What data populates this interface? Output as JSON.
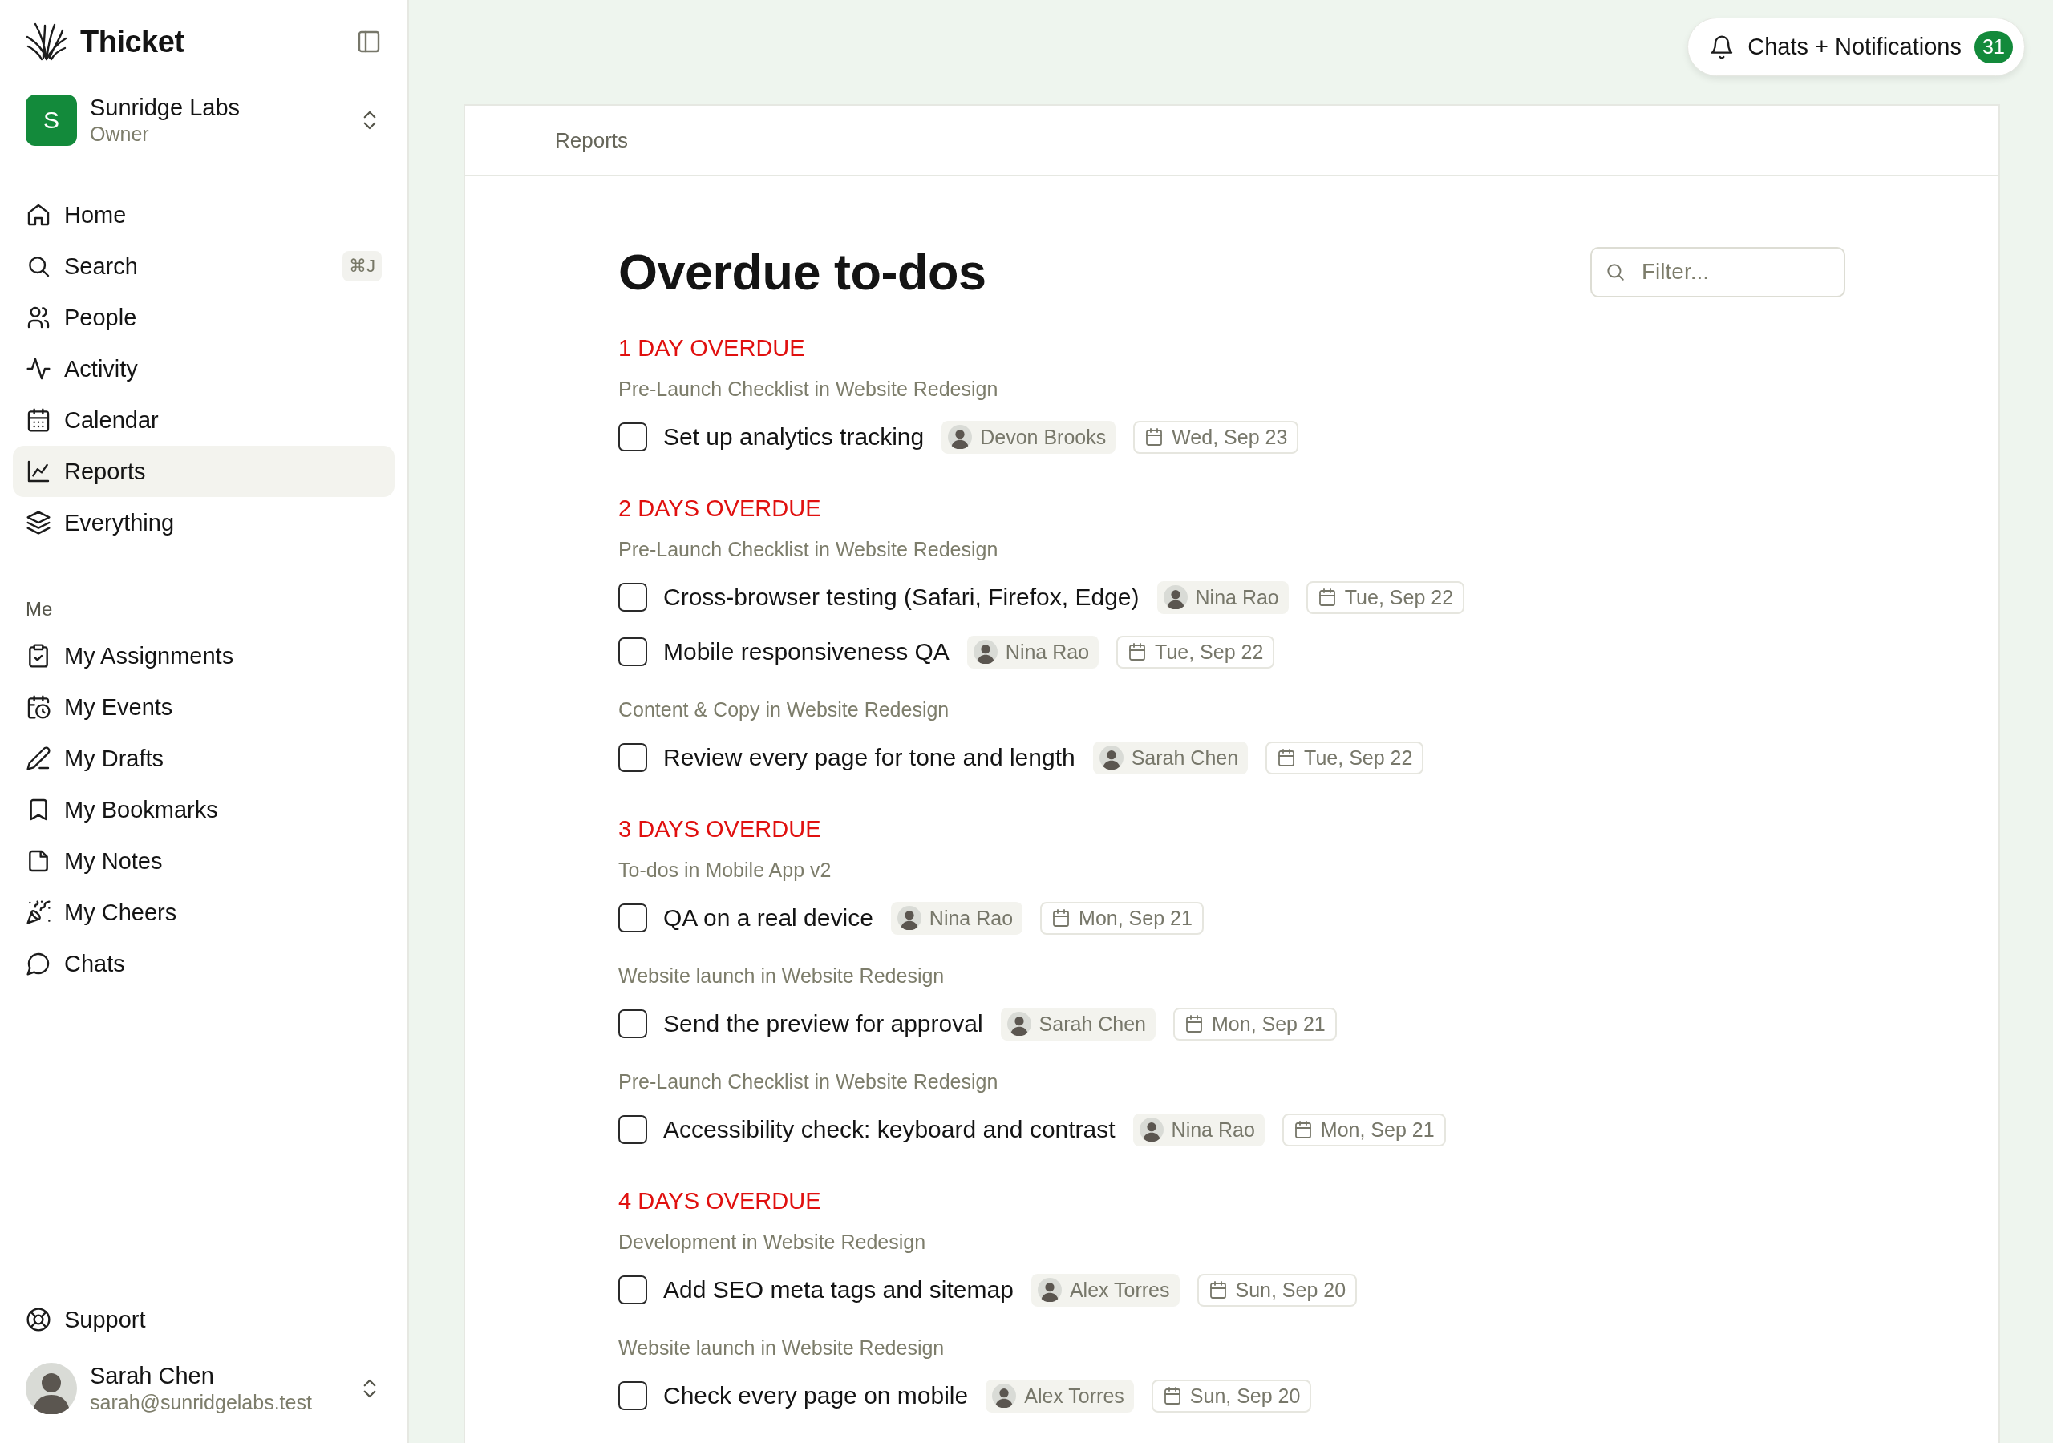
{
  "brand": {
    "name": "Thicket"
  },
  "workspace": {
    "initial": "S",
    "name": "Sunridge Labs",
    "role": "Owner"
  },
  "nav": [
    {
      "label": "Home",
      "kind": "home",
      "selected": false
    },
    {
      "label": "Search",
      "kind": "search",
      "selected": false,
      "shortcut": "⌘J"
    },
    {
      "label": "People",
      "kind": "people",
      "selected": false
    },
    {
      "label": "Activity",
      "kind": "activity",
      "selected": false
    },
    {
      "label": "Calendar",
      "kind": "calendar",
      "selected": false
    },
    {
      "label": "Reports",
      "kind": "reports",
      "selected": true
    },
    {
      "label": "Everything",
      "kind": "layers",
      "selected": false
    }
  ],
  "me_section": {
    "heading": "Me",
    "items": [
      {
        "label": "My Assignments",
        "kind": "assignments",
        "selected": false
      },
      {
        "label": "My Events",
        "kind": "events",
        "selected": false
      },
      {
        "label": "My Drafts",
        "kind": "drafts",
        "selected": false
      },
      {
        "label": "My Bookmarks",
        "kind": "bookmarks",
        "selected": false
      },
      {
        "label": "My Notes",
        "kind": "notes",
        "selected": false
      },
      {
        "label": "My Cheers",
        "kind": "cheers",
        "selected": false
      },
      {
        "label": "Chats",
        "kind": "chats",
        "selected": false
      }
    ]
  },
  "footer": {
    "support": "Support",
    "user": {
      "name": "Sarah Chen",
      "email": "sarah@sunridgelabs.test"
    }
  },
  "notifications": {
    "label": "Chats + Notifications",
    "count": "31"
  },
  "breadcrumb": "Reports",
  "page": {
    "title": "Overdue to-dos",
    "filter": {
      "placeholder": "Filter..."
    },
    "groups": [
      {
        "heading": "1 DAY OVERDUE",
        "lists": [
          {
            "name": "Pre-Launch Checklist in Website Redesign",
            "todos": [
              {
                "title": "Set up analytics tracking",
                "checked": false,
                "assignee": "Devon Brooks",
                "due": "Wed, Sep 23"
              }
            ]
          }
        ]
      },
      {
        "heading": "2 DAYS OVERDUE",
        "lists": [
          {
            "name": "Pre-Launch Checklist in Website Redesign",
            "todos": [
              {
                "title": "Cross-browser testing (Safari, Firefox, Edge)",
                "checked": false,
                "assignee": "Nina Rao",
                "due": "Tue, Sep 22"
              },
              {
                "title": "Mobile responsiveness QA",
                "checked": false,
                "assignee": "Nina Rao",
                "due": "Tue, Sep 22"
              }
            ]
          },
          {
            "name": "Content & Copy in Website Redesign",
            "todos": [
              {
                "title": "Review every page for tone and length",
                "checked": false,
                "assignee": "Sarah Chen",
                "due": "Tue, Sep 22"
              }
            ]
          }
        ]
      },
      {
        "heading": "3 DAYS OVERDUE",
        "lists": [
          {
            "name": "To-dos in Mobile App v2",
            "todos": [
              {
                "title": "QA on a real device",
                "checked": false,
                "assignee": "Nina Rao",
                "due": "Mon, Sep 21"
              }
            ]
          },
          {
            "name": "Website launch in Website Redesign",
            "todos": [
              {
                "title": "Send the preview for approval",
                "checked": false,
                "assignee": "Sarah Chen",
                "due": "Mon, Sep 21"
              }
            ]
          },
          {
            "name": "Pre-Launch Checklist in Website Redesign",
            "todos": [
              {
                "title": "Accessibility check: keyboard and contrast",
                "checked": false,
                "assignee": "Nina Rao",
                "due": "Mon, Sep 21"
              }
            ]
          }
        ]
      },
      {
        "heading": "4 DAYS OVERDUE",
        "lists": [
          {
            "name": "Development in Website Redesign",
            "todos": [
              {
                "title": "Add SEO meta tags and sitemap",
                "checked": false,
                "assignee": "Alex Torres",
                "due": "Sun, Sep 20"
              }
            ]
          },
          {
            "name": "Website launch in Website Redesign",
            "todos": [
              {
                "title": "Check every page on mobile",
                "checked": false,
                "assignee": "Alex Torres",
                "due": "Sun, Sep 20"
              }
            ]
          }
        ]
      }
    ]
  }
}
